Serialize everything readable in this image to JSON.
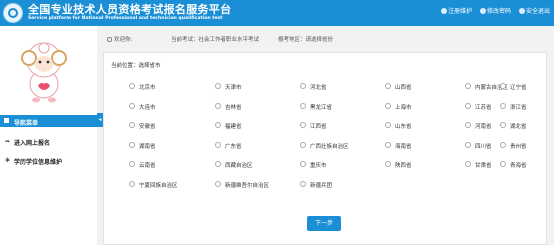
{
  "header": {
    "title": "全国专业技术人员资格考试报名服务平台",
    "subtitle": "Service platform for National Professional and technician qualification test",
    "links": [
      "注册维护",
      "修改密码",
      "安全退出"
    ]
  },
  "sidebar": {
    "nav_title": "导航菜单",
    "items": [
      {
        "label": "进入网上报名",
        "icon": "share-arrow-icon"
      },
      {
        "label": "学历学位信息维护",
        "icon": "graduation-cap-icon"
      }
    ],
    "collapse_glyph": "◂"
  },
  "topbar": {
    "welcome": "欢迎你:",
    "exam": "当前考试：社会工作者职业水平考试",
    "region": "报考地区：请选择省份"
  },
  "content": {
    "location": "当前位置：选择省市",
    "provinces": [
      [
        "北京市",
        "天津市",
        "河北省",
        "山西省",
        "内蒙古自治区",
        "辽宁省"
      ],
      [
        "大连市",
        "吉林省",
        "黑龙江省",
        "上海市",
        "江苏省",
        "浙江省"
      ],
      [
        "安徽省",
        "福建省",
        "江西省",
        "山东省",
        "河南省",
        "湖北省"
      ],
      [
        "湖南省",
        "广东省",
        "广西壮族自治区",
        "海南省",
        "四川省",
        "贵州省"
      ],
      [
        "云南省",
        "西藏自治区",
        "重庆市",
        "陕西省",
        "甘肃省",
        "青海省"
      ],
      [
        "宁夏回族自治区",
        "新疆维吾尔自治区",
        "新疆兵团"
      ]
    ],
    "next_button": "下一步"
  },
  "colors": {
    "primary": "#1b8fd6"
  }
}
